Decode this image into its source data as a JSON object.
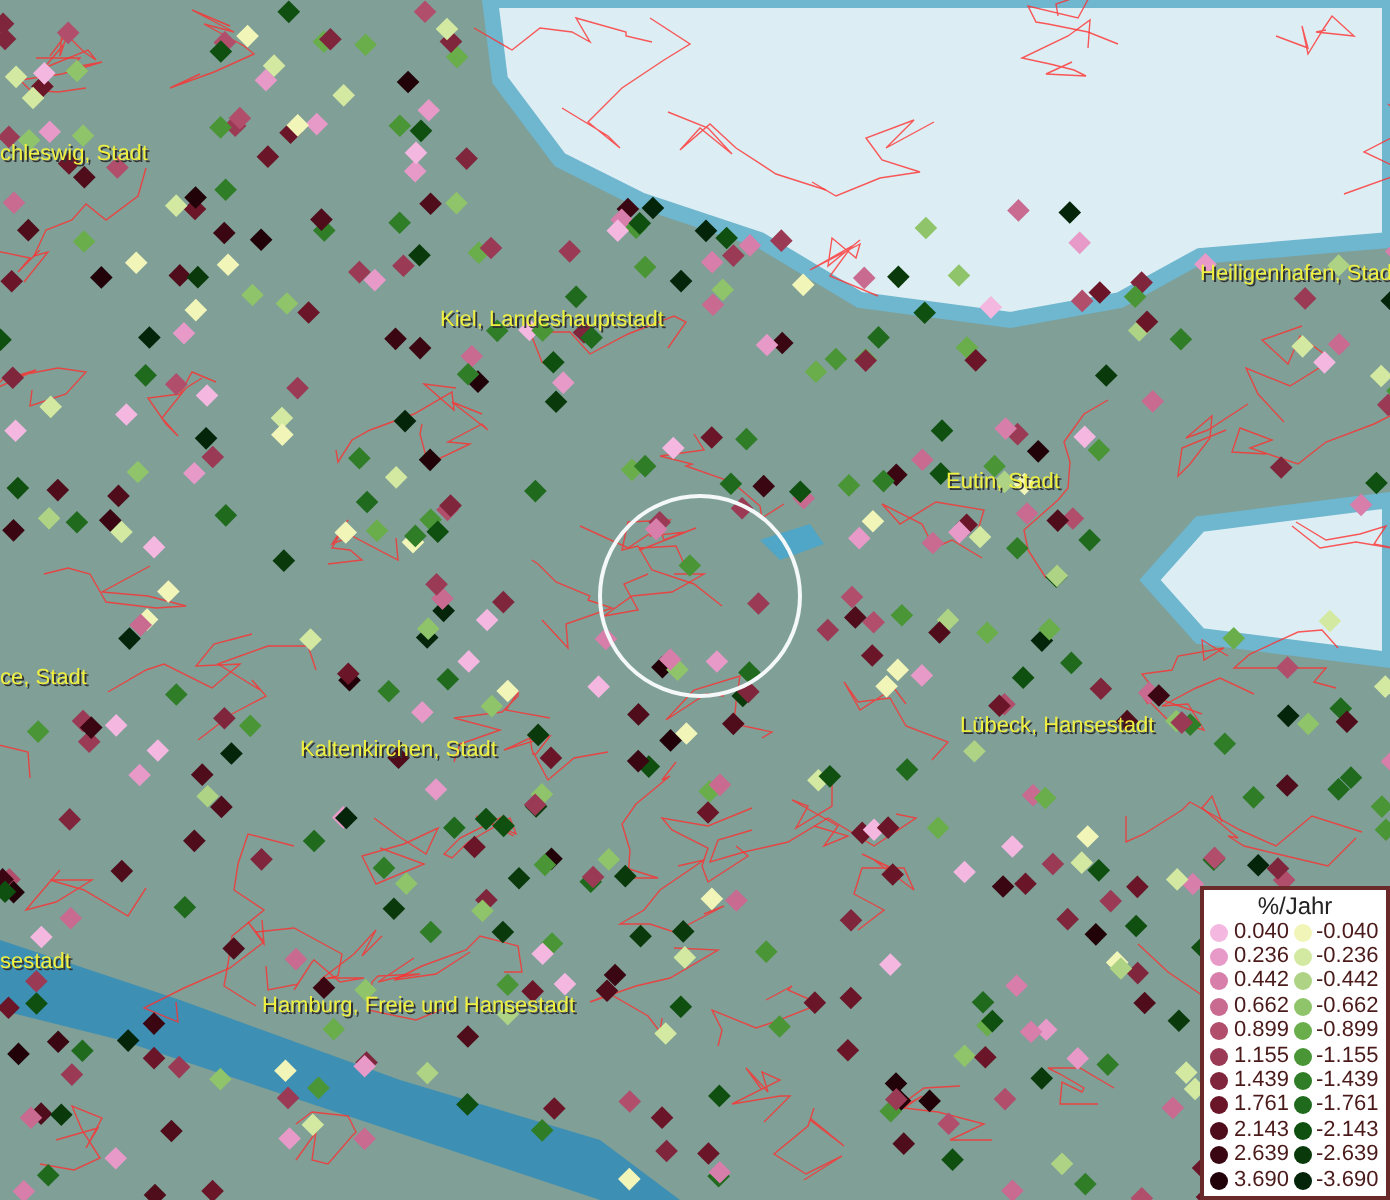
{
  "map": {
    "places": [
      {
        "name": "chleswig, Stadt"
      },
      {
        "name": "Kiel, Landeshauptstadt"
      },
      {
        "name": "Heiligenhafen, Stad"
      },
      {
        "name": "Eutin, Stadt"
      },
      {
        "name": "ce, Stadt"
      },
      {
        "name": "Kaltenkirchen, Stadt"
      },
      {
        "name": "Lübeck, Hansestadt"
      },
      {
        "name": "sestadt"
      },
      {
        "name": "Hamburg, Freie und Hansestadt"
      }
    ]
  },
  "legend": {
    "title": "%/Jahr",
    "rows": [
      {
        "positive": {
          "label": "0.040",
          "color": "#f4b8e0"
        },
        "negative": {
          "label": "-0.040",
          "color": "#f2f5b8"
        }
      },
      {
        "positive": {
          "label": "0.236",
          "color": "#e79ac8"
        },
        "negative": {
          "label": "-0.236",
          "color": "#d3e8a0"
        }
      },
      {
        "positive": {
          "label": "0.442",
          "color": "#d77eab"
        },
        "negative": {
          "label": "-0.442",
          "color": "#aed384"
        }
      },
      {
        "positive": {
          "label": "0.662",
          "color": "#c96a90"
        },
        "negative": {
          "label": "-0.662",
          "color": "#8fc46a"
        }
      },
      {
        "positive": {
          "label": "0.899",
          "color": "#b14e6c"
        },
        "negative": {
          "label": "-0.899",
          "color": "#6aae4c"
        }
      },
      {
        "positive": {
          "label": "1.155",
          "color": "#9a3a55"
        },
        "negative": {
          "label": "-1.155",
          "color": "#4a9636"
        }
      },
      {
        "positive": {
          "label": "1.439",
          "color": "#80263c"
        },
        "negative": {
          "label": "-1.439",
          "color": "#307d28"
        }
      },
      {
        "positive": {
          "label": "1.761",
          "color": "#6a1628"
        },
        "negative": {
          "label": "-1.761",
          "color": "#1f6a1c"
        }
      },
      {
        "positive": {
          "label": "2.143",
          "color": "#4f0c1a"
        },
        "negative": {
          "label": "-2.143",
          "color": "#0f4f10"
        }
      },
      {
        "positive": {
          "label": "2.639",
          "color": "#3a0612"
        },
        "negative": {
          "label": "-2.639",
          "color": "#0a3a0b"
        }
      },
      {
        "positive": {
          "label": "3.690",
          "color": "#200208"
        },
        "negative": {
          "label": "-3.690",
          "color": "#04250a"
        }
      }
    ]
  }
}
